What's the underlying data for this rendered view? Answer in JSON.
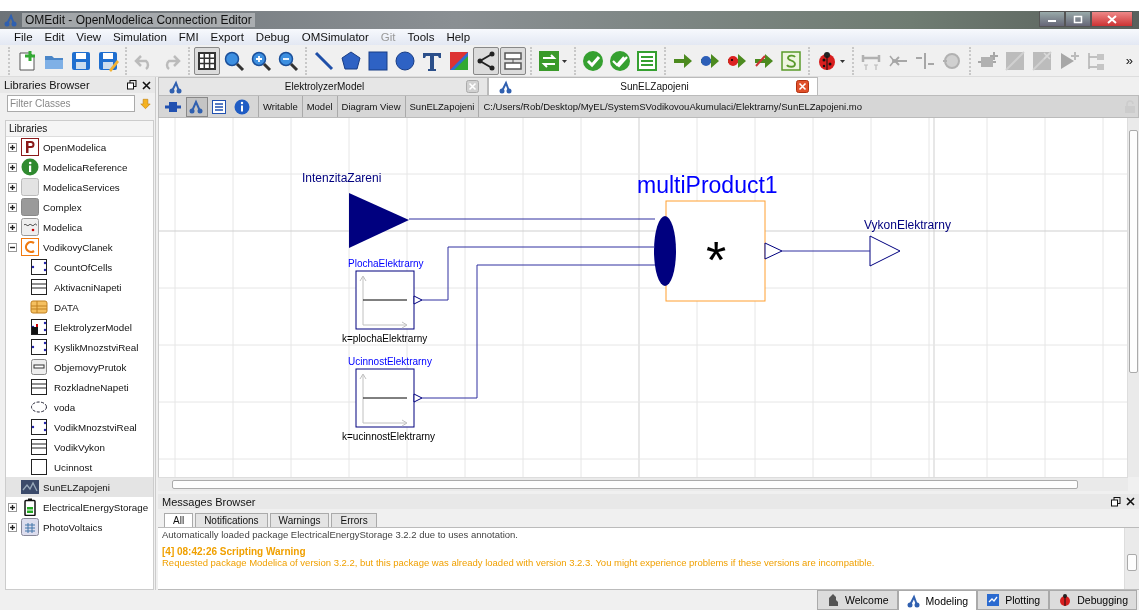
{
  "window": {
    "title": "OMEdit - OpenModelica Connection Editor"
  },
  "menu": [
    {
      "label": "File",
      "disabled": false
    },
    {
      "label": "Edit",
      "disabled": false
    },
    {
      "label": "View",
      "disabled": false
    },
    {
      "label": "Simulation",
      "disabled": false
    },
    {
      "label": "FMI",
      "disabled": false
    },
    {
      "label": "Export",
      "disabled": false
    },
    {
      "label": "Debug",
      "disabled": false
    },
    {
      "label": "OMSimulator",
      "disabled": false
    },
    {
      "label": "Git",
      "disabled": true
    },
    {
      "label": "Tools",
      "disabled": false
    },
    {
      "label": "Help",
      "disabled": false
    }
  ],
  "toolbar": [
    {
      "tools": [
        {
          "kind": "new",
          "disabled": false,
          "pressed": false
        },
        {
          "kind": "open",
          "disabled": false,
          "pressed": false
        },
        {
          "kind": "save",
          "disabled": false,
          "pressed": false
        },
        {
          "kind": "save-all",
          "disabled": false,
          "pressed": false
        }
      ]
    },
    {
      "tools": [
        {
          "kind": "undo",
          "disabled": true,
          "pressed": false
        },
        {
          "kind": "redo",
          "disabled": true,
          "pressed": false
        }
      ]
    },
    {
      "tools": [
        {
          "kind": "grid",
          "disabled": false,
          "pressed": true
        },
        {
          "kind": "zoom",
          "disabled": false,
          "pressed": false
        },
        {
          "kind": "zoom-in",
          "disabled": false,
          "pressed": false
        },
        {
          "kind": "zoom-out",
          "disabled": false,
          "pressed": false
        }
      ]
    },
    {
      "tools": [
        {
          "kind": "line",
          "disabled": false,
          "pressed": false
        },
        {
          "kind": "polygon",
          "disabled": false,
          "pressed": false
        },
        {
          "kind": "rectangle",
          "disabled": false,
          "pressed": false
        },
        {
          "kind": "ellipse",
          "disabled": false,
          "pressed": false
        },
        {
          "kind": "text",
          "disabled": false,
          "pressed": false
        },
        {
          "kind": "bitmap",
          "disabled": false,
          "pressed": false
        },
        {
          "kind": "connect",
          "disabled": false,
          "pressed": true
        },
        {
          "kind": "transition",
          "disabled": false,
          "pressed": true
        }
      ]
    },
    {
      "tools": [
        {
          "kind": "swap-menu",
          "disabled": false,
          "pressed": false
        }
      ]
    },
    {
      "tools": [
        {
          "kind": "validate",
          "disabled": false,
          "pressed": false
        },
        {
          "kind": "validate-all",
          "disabled": false,
          "pressed": false
        },
        {
          "kind": "instantiate",
          "disabled": false,
          "pressed": false
        }
      ]
    },
    {
      "tools": [
        {
          "kind": "simulate",
          "disabled": false,
          "pressed": false
        },
        {
          "kind": "simulate-debug",
          "disabled": false,
          "pressed": false
        },
        {
          "kind": "simulate-algorithmic-debug",
          "disabled": false,
          "pressed": false
        },
        {
          "kind": "simulate-animate",
          "disabled": false,
          "pressed": false
        },
        {
          "kind": "script",
          "disabled": false,
          "pressed": false
        }
      ]
    },
    {
      "tools": [
        {
          "kind": "bug-menu",
          "disabled": false,
          "pressed": false
        }
      ]
    },
    {
      "tools": [
        {
          "kind": "time-range",
          "disabled": true,
          "pressed": false
        },
        {
          "kind": "arrow-left",
          "disabled": true,
          "pressed": false
        },
        {
          "kind": "arrow-in",
          "disabled": true,
          "pressed": false
        },
        {
          "kind": "ring",
          "disabled": true,
          "pressed": false
        }
      ]
    },
    {
      "tools": [
        {
          "kind": "block-plus",
          "disabled": true,
          "pressed": false
        },
        {
          "kind": "diag",
          "disabled": true,
          "pressed": false
        },
        {
          "kind": "diag-x",
          "disabled": true,
          "pressed": false
        },
        {
          "kind": "play-plus",
          "disabled": true,
          "pressed": false
        },
        {
          "kind": "tree",
          "disabled": true,
          "pressed": false
        }
      ]
    }
  ],
  "toolbar_overflow": "»",
  "libraries_browser": {
    "title": "Libraries Browser",
    "filter": {
      "placeholder": "Filter Classes"
    },
    "heading": "Libraries",
    "items": [
      {
        "label": "OpenModelica",
        "kind": "package",
        "expanded": false,
        "selected": false
      },
      {
        "label": "ModelicaReference",
        "kind": "package",
        "expanded": false,
        "selected": false
      },
      {
        "label": "ModelicaServices",
        "kind": "package",
        "expanded": false,
        "selected": false
      },
      {
        "label": "Complex",
        "kind": "package",
        "expanded": false,
        "selected": false
      },
      {
        "label": "Modelica",
        "kind": "package",
        "expanded": false,
        "selected": false
      },
      {
        "label": "VodikovyClanek",
        "kind": "package",
        "expanded": true,
        "selected": false,
        "children": [
          {
            "label": "CountOfCells",
            "selected": false
          },
          {
            "label": "AktivacniNapeti",
            "selected": false
          },
          {
            "label": "DATA",
            "selected": false
          },
          {
            "label": "ElektrolyzerModel",
            "selected": false
          },
          {
            "label": "KyslikMnozstviReal",
            "selected": false
          },
          {
            "label": "ObjemovyPrutok",
            "selected": false
          },
          {
            "label": "RozkladneNapeti",
            "selected": false
          },
          {
            "label": "voda",
            "selected": false
          },
          {
            "label": "VodikMnozstviReal",
            "selected": false
          },
          {
            "label": "VodikVykon",
            "selected": false
          },
          {
            "label": "Ucinnost",
            "selected": false
          }
        ]
      },
      {
        "label": "SunELZapojeni",
        "kind": "model",
        "selected": true
      },
      {
        "label": "ElectricalEnergyStorage",
        "kind": "package",
        "expanded": false,
        "selected": false
      },
      {
        "label": "PhotoVoltaics",
        "kind": "package",
        "expanded": false,
        "selected": false
      }
    ]
  },
  "document_tabs": [
    {
      "label": "ElektrolyzerModel",
      "selected": false
    },
    {
      "label": "SunELZapojeni",
      "selected": true
    }
  ],
  "view_buttons": [
    {
      "kind": "icon-view",
      "selected": false
    },
    {
      "kind": "diagram-view",
      "selected": true
    },
    {
      "kind": "text-view",
      "selected": false
    },
    {
      "kind": "documentation",
      "selected": false
    }
  ],
  "model_info": [
    "Writable",
    "Model",
    "Diagram View",
    "SunELZapojeni",
    "C:/Users/Rob/Desktop/MyEL/SystemSVodikovouAkumulaci/Elektrarny/SunELZapojeni.mo"
  ],
  "diagram": {
    "components": [
      {
        "kind": "real-input",
        "name": "IntenzitaZareni"
      },
      {
        "kind": "constant",
        "name": "PlochaElektrarny",
        "parameter": "k=plochaElektrarny"
      },
      {
        "kind": "constant",
        "name": "UcinnostElektrarny",
        "parameter": "k=ucinnostElektrarny"
      },
      {
        "kind": "multi-product",
        "name": "multiProduct1",
        "symbol": "*"
      },
      {
        "kind": "real-output",
        "name": "VykonElektrarny"
      }
    ]
  },
  "messages_browser": {
    "title": "Messages Browser",
    "tabs": [
      {
        "label": "All",
        "selected": true
      },
      {
        "label": "Notifications",
        "selected": false
      },
      {
        "label": "Warnings",
        "selected": false
      },
      {
        "label": "Errors",
        "selected": false
      }
    ],
    "messages": [
      {
        "kind": "notification",
        "text": "Automatically loaded package ElectricalEnergyStorage 3.2.2 due to uses annotation."
      },
      {
        "kind": "warning",
        "header": "[4] 08:42:26 Scripting Warning",
        "text": "Requested package Modelica of version 3.2.2, but this package was already loaded with version 3.2.3. You might experience problems if these versions are incompatible."
      }
    ]
  },
  "perspectives": [
    {
      "label": "Welcome",
      "selected": false
    },
    {
      "label": "Modeling",
      "selected": true
    },
    {
      "label": "Plotting",
      "selected": false
    },
    {
      "label": "Debugging",
      "selected": false
    }
  ]
}
